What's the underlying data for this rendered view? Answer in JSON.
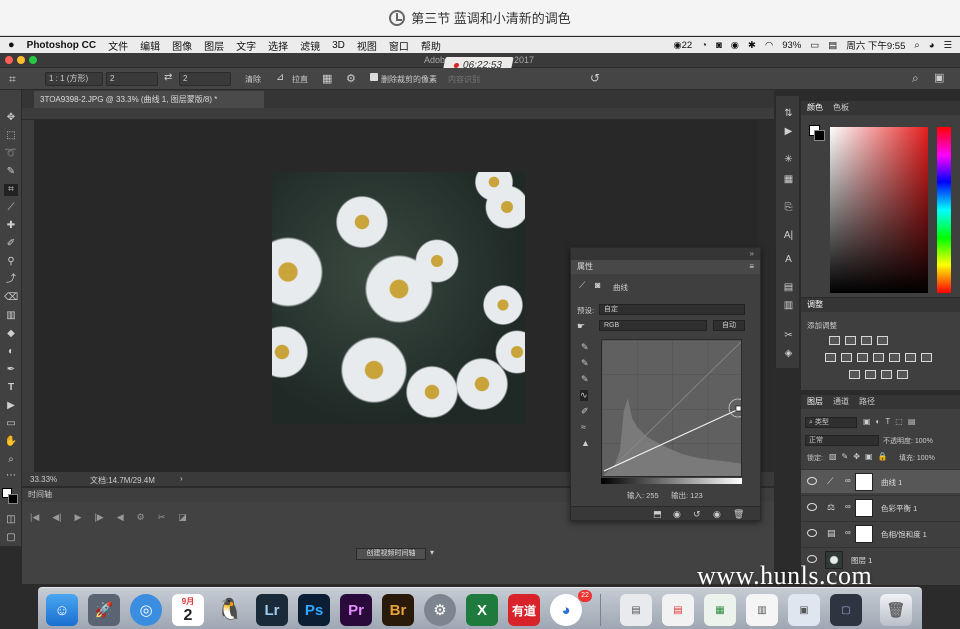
{
  "video": {
    "title": "第三节 蓝调和小清新的调色"
  },
  "menubar": {
    "app": "Photoshop CC",
    "items": [
      "文件",
      "编辑",
      "图像",
      "图层",
      "文字",
      "选择",
      "滤镜",
      "3D",
      "视图",
      "窗口",
      "帮助"
    ],
    "badge_count": "22",
    "battery": "93%",
    "clock": "周六 下午9:55"
  },
  "ps": {
    "title_left": "Adob",
    "title_right": "2017",
    "recording_time": "06:22:53",
    "options": {
      "ratio_select": "1 : 1 (方形)",
      "ratio_w": "2",
      "ratio_h": "2",
      "clear_button": "清除",
      "straighten_label": "拉直",
      "delete_cropped_label": "删除裁剪的像素",
      "content_aware_label": "内容识别"
    },
    "doc_tab": "3TOA9398-2.JPG @ 33.3% (曲线 1, 图层蒙版/8) *",
    "status": {
      "zoom": "33.33%",
      "doc_size": "文档:14.7M/29.4M"
    },
    "timeline": {
      "title": "时间轴",
      "create_button": "创建视频时间轴"
    }
  },
  "properties": {
    "panel_title": "属性",
    "tab_label": "曲线",
    "preset_label": "预设:",
    "preset_value": "自定",
    "channel_value": "RGB",
    "auto_button": "自动",
    "input_label": "输入: 255",
    "output_label": "输出: 123"
  },
  "right_panels": {
    "color_tabs": [
      "颜色",
      "色板"
    ],
    "adjustments_title": "调整",
    "adjustments_subtitle": "添加调整",
    "layers_tabs": [
      "图层",
      "通道",
      "路径"
    ],
    "filter_type": "类型",
    "blend_mode": "正常",
    "opacity_label": "不透明度: 100%",
    "lock_label": "锁定:",
    "fill_label": "填充: 100%",
    "layers": [
      {
        "name": "曲线 1",
        "icon": "curves-icon"
      },
      {
        "name": "色彩平衡 1",
        "icon": "balance-icon"
      },
      {
        "name": "色相/饱和度 1",
        "icon": "hue-icon"
      },
      {
        "name": "图层 1",
        "icon": "image-icon"
      }
    ]
  },
  "dock": {
    "calendar_month": "9月",
    "calendar_day": "2",
    "lr": "Lr",
    "ps": "Ps",
    "pr": "Pr",
    "br": "Br",
    "youdao": "有道",
    "badge": "22"
  },
  "watermark": "www.hunls.com"
}
